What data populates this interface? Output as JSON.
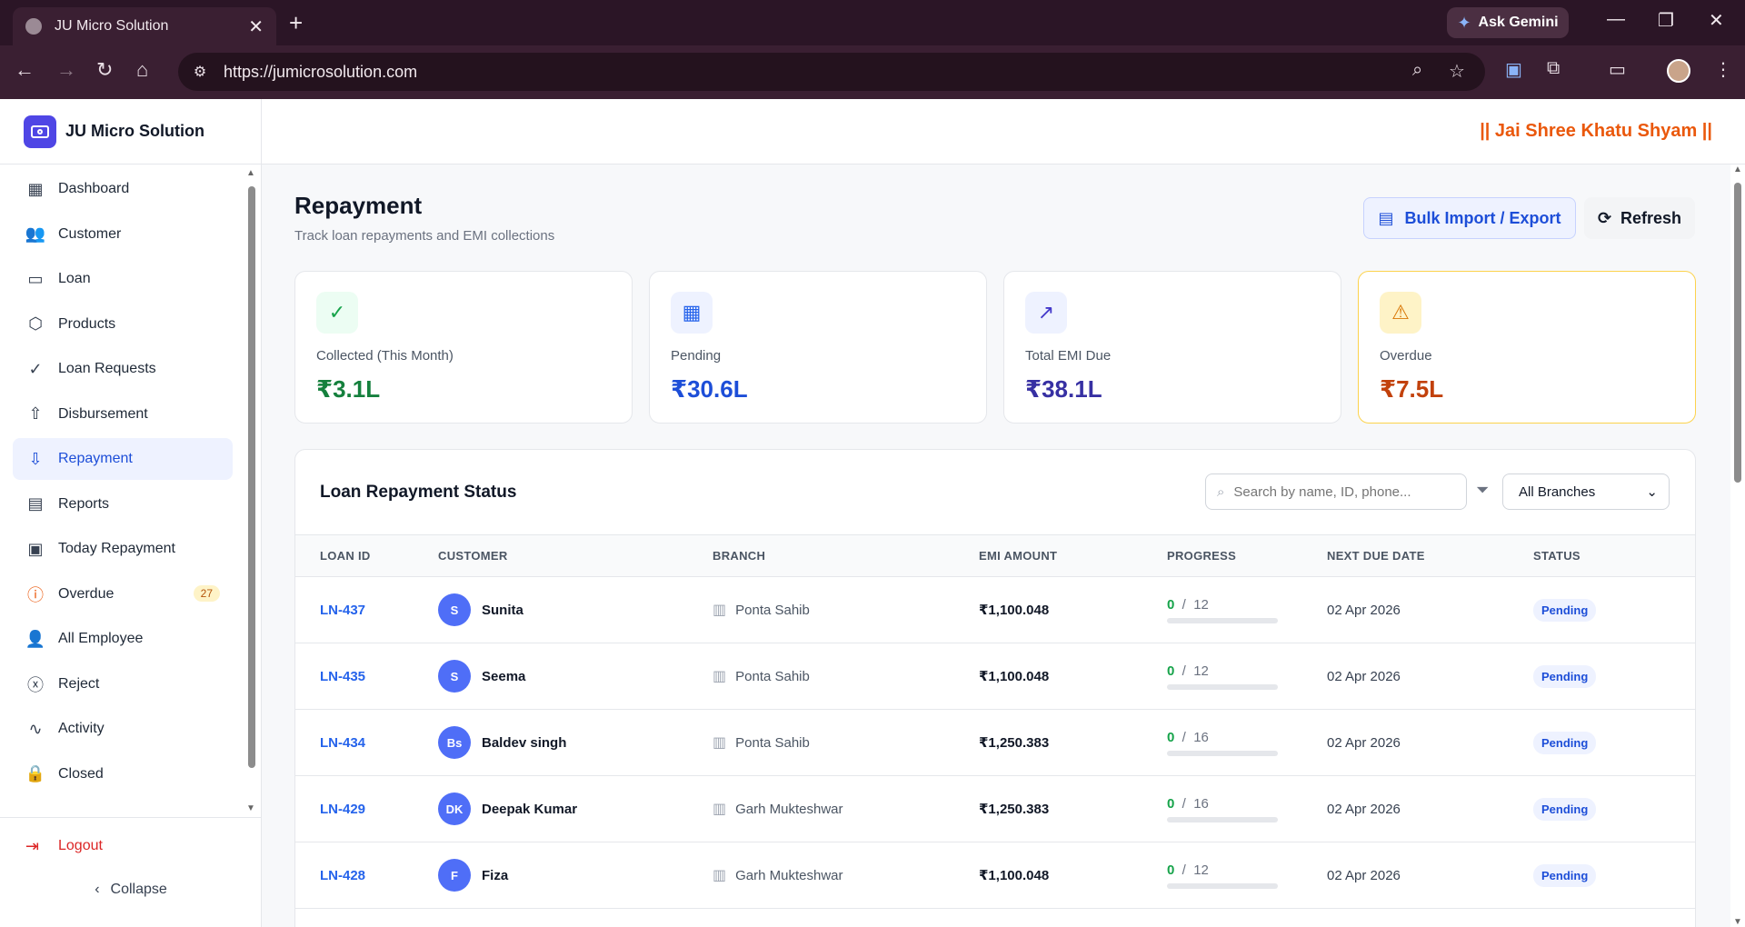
{
  "browser": {
    "tab_title": "JU Micro Solution",
    "url": "https://jumicrosolution.com",
    "gemini_label": "Ask Gemini"
  },
  "brand": {
    "name": "JU Micro Solution"
  },
  "motto": "|| Jai Shree Khatu Shyam ||",
  "sidebar": {
    "items": [
      {
        "label": "Dashboard",
        "icon": "dashboard-icon"
      },
      {
        "label": "Customer",
        "icon": "users-icon"
      },
      {
        "label": "Loan",
        "icon": "banknote-icon"
      },
      {
        "label": "Products",
        "icon": "package-icon"
      },
      {
        "label": "Loan Requests",
        "icon": "check-circle-icon"
      },
      {
        "label": "Disbursement",
        "icon": "arrow-up-circle-icon"
      },
      {
        "label": "Repayment",
        "icon": "arrow-down-circle-icon",
        "active": true
      },
      {
        "label": "Reports",
        "icon": "file-text-icon"
      },
      {
        "label": "Today Repayment",
        "icon": "calendar-icon"
      },
      {
        "label": "Overdue",
        "icon": "alert-circle-icon",
        "badge": "27"
      },
      {
        "label": "All Employee",
        "icon": "user-cog-icon"
      },
      {
        "label": "Reject",
        "icon": "x-circle-icon"
      },
      {
        "label": "Activity",
        "icon": "activity-icon"
      },
      {
        "label": "Closed",
        "icon": "lock-icon"
      }
    ],
    "logout_label": "Logout",
    "collapse_label": "Collapse"
  },
  "page": {
    "title": "Repayment",
    "subtitle": "Track loan repayments and EMI collections",
    "bulk_label": "Bulk Import / Export",
    "refresh_label": "Refresh"
  },
  "cards": [
    {
      "label": "Collected (This Month)",
      "value": "₹3.1L",
      "color": "#15803d",
      "icon_bg": "#ecfdf3"
    },
    {
      "label": "Pending",
      "value": "₹30.6L",
      "color": "#1d4ed8",
      "icon_bg": "#eef2ff"
    },
    {
      "label": "Total EMI Due",
      "value": "₹38.1L",
      "color": "#3730a3",
      "icon_bg": "#eef2ff"
    },
    {
      "label": "Overdue",
      "value": "₹7.5L",
      "color": "#c2410c",
      "icon_bg": "#fef3c7"
    }
  ],
  "panel": {
    "title": "Loan Repayment Status",
    "search_placeholder": "Search by name, ID, phone...",
    "branch_filter": "All Branches",
    "columns": [
      "LOAN ID",
      "CUSTOMER",
      "BRANCH",
      "EMI AMOUNT",
      "PROGRESS",
      "NEXT DUE DATE",
      "STATUS"
    ],
    "rows": [
      {
        "loan_id": "LN-437",
        "initials": "S",
        "customer": "Sunita",
        "branch": "Ponta Sahib",
        "emi": "₹1,100.048",
        "paid": "0",
        "total": "12",
        "progress": 0,
        "due": "02 Apr 2026",
        "status": "Pending"
      },
      {
        "loan_id": "LN-435",
        "initials": "S",
        "customer": "Seema",
        "branch": "Ponta Sahib",
        "emi": "₹1,100.048",
        "paid": "0",
        "total": "12",
        "progress": 0,
        "due": "02 Apr 2026",
        "status": "Pending"
      },
      {
        "loan_id": "LN-434",
        "initials": "Bs",
        "customer": "Baldev singh",
        "branch": "Ponta Sahib",
        "emi": "₹1,250.383",
        "paid": "0",
        "total": "16",
        "progress": 0,
        "due": "02 Apr 2026",
        "status": "Pending"
      },
      {
        "loan_id": "LN-429",
        "initials": "DK",
        "customer": "Deepak Kumar",
        "branch": "Garh Mukteshwar",
        "emi": "₹1,250.383",
        "paid": "0",
        "total": "16",
        "progress": 0,
        "due": "02 Apr 2026",
        "status": "Pending"
      },
      {
        "loan_id": "LN-428",
        "initials": "F",
        "customer": "Fiza",
        "branch": "Garh Mukteshwar",
        "emi": "₹1,100.048",
        "paid": "0",
        "total": "12",
        "progress": 0,
        "due": "02 Apr 2026",
        "status": "Pending"
      }
    ]
  }
}
